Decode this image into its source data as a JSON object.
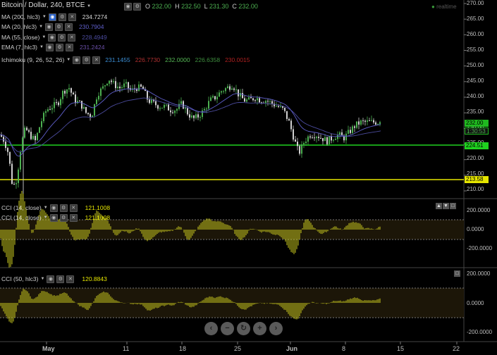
{
  "header": {
    "symbol": "Bitcoin / Dollar, 240, BTCE",
    "o_label": "O",
    "o_value": "232.00",
    "h_label": "H",
    "h_value": "232.50",
    "l_label": "L",
    "l_value": "231.30",
    "c_label": "C",
    "c_value": "232.00",
    "realtime": "realtime"
  },
  "indicators": [
    {
      "label": "MA (200, hlc3)",
      "value": "234.7274",
      "color": "#d9d9d9"
    },
    {
      "label": "MA (20, hlc3)",
      "value": "230.7904",
      "color": "#5e5ec9"
    },
    {
      "label": "MA (55, close)",
      "value": "228.4949",
      "color": "#4b4b9e"
    },
    {
      "label": "EMA (7, hlc3)",
      "value": "231.2424",
      "color": "#6a4fa8"
    }
  ],
  "ichimoku": {
    "label": "Ichimoku (9, 26, 52, 26)",
    "values": [
      {
        "v": "231.1455",
        "color": "#3c8fd6"
      },
      {
        "v": "226.7730",
        "color": "#b03030"
      },
      {
        "v": "232.0000",
        "color": "#55b855"
      },
      {
        "v": "226.6358",
        "color": "#3f8f3f"
      },
      {
        "v": "230.0015",
        "color": "#b02020"
      }
    ]
  },
  "price_axis": [
    "270.00",
    "265.00",
    "260.00",
    "255.00",
    "250.00",
    "245.00",
    "240.00",
    "235.00",
    "230.00",
    "225.00",
    "220.00",
    "215.00",
    "210.00"
  ],
  "price_tags": {
    "current": "232.00",
    "countdown": "1:30:53",
    "green_line": "224.51",
    "yellow_line": "213.58"
  },
  "cci1": {
    "label1": "CCI (14, close)",
    "value1": "121.1008",
    "label2": "CCI (14, close)",
    "value2": "121.1008",
    "axis": [
      "200.0000",
      "0.0000",
      "-200.0000"
    ]
  },
  "cci2": {
    "label": "CCI (50, hlc3)",
    "value": "120.8843",
    "axis": [
      "200.0000",
      "0.0000",
      "-200.0000"
    ]
  },
  "time_axis": [
    "May",
    "11",
    "18",
    "25",
    "Jun",
    "8",
    "15",
    "22"
  ],
  "colors": {
    "up": "#4caf50",
    "down": "#d0d0d0",
    "green_line": "#1fd11f",
    "yellow_line": "#e6e600",
    "cci": "#c8c81e"
  }
}
